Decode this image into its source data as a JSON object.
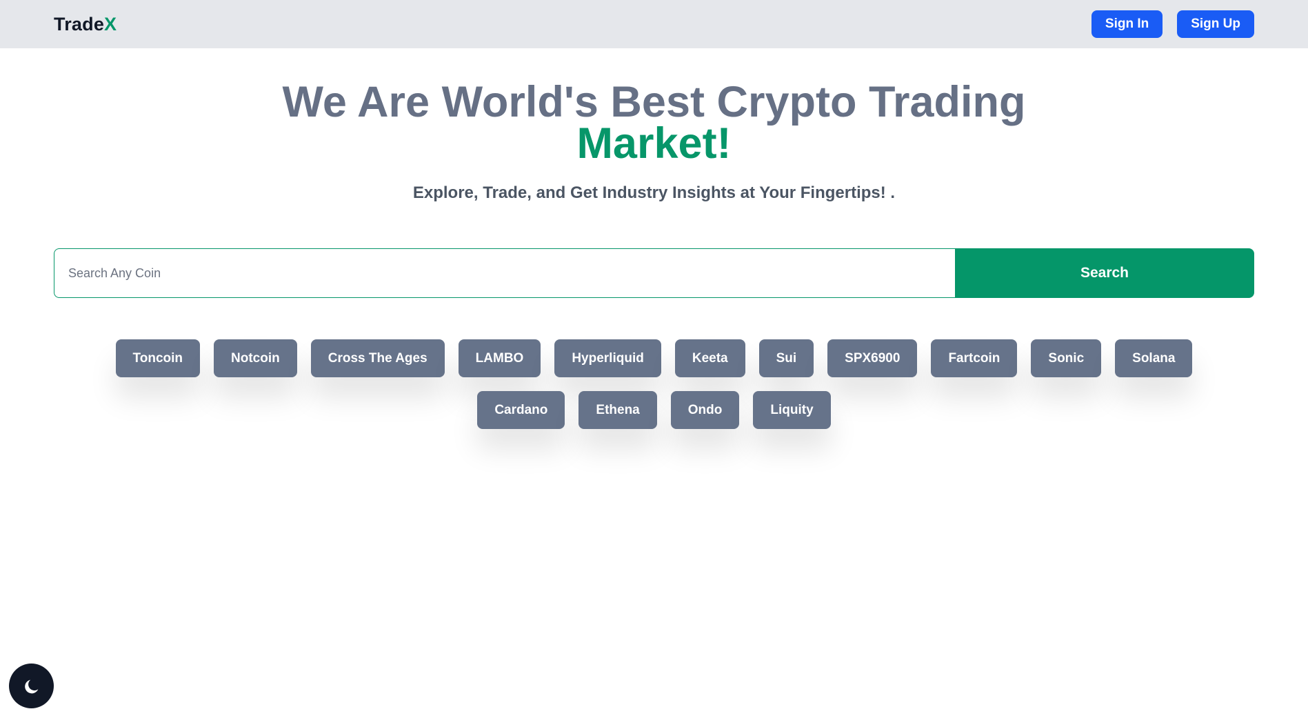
{
  "navbar": {
    "logo_main": "Trade",
    "logo_accent": "X",
    "sign_in": "Sign In",
    "sign_up": "Sign Up"
  },
  "hero": {
    "title": "We Are World's Best Crypto Trading",
    "title_highlight": "Market!",
    "subtitle": "Explore, Trade, and Get Industry Insights at Your Fingertips! ."
  },
  "search": {
    "placeholder": "Search Any Coin",
    "value": "",
    "button_label": "Search"
  },
  "coins": {
    "row1": [
      "Toncoin",
      "Notcoin",
      "Cross The Ages",
      "LAMBO",
      "Hyperliquid",
      "Keeta",
      "Sui",
      "SPX6900",
      "Fartcoin",
      "Sonic",
      "Solana"
    ],
    "row2": [
      "Cardano",
      "Ethena",
      "Ondo",
      "Liquity"
    ]
  },
  "theme_toggle": {
    "icon": "moon-icon"
  },
  "colors": {
    "accent_green": "#059669",
    "button_blue": "#1a5cf5",
    "coin_chip": "#66738a",
    "navbar_bg": "#e5e7eb"
  }
}
